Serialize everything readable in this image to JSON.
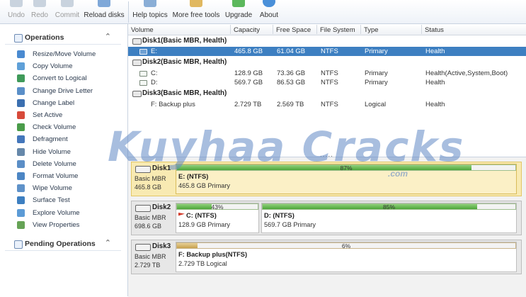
{
  "toolbar": {
    "undo": "Undo",
    "redo": "Redo",
    "commit": "Commit",
    "reload": "Reload disks",
    "help": "Help topics",
    "more_tools": "More free tools",
    "upgrade": "Upgrade",
    "about": "About"
  },
  "sidebar": {
    "operations_title": "Operations",
    "operations": [
      {
        "label": "Resize/Move Volume",
        "icon": "resize-icon",
        "color": "#4a8ad0"
      },
      {
        "label": "Copy Volume",
        "icon": "copy-icon",
        "color": "#5fa0d8"
      },
      {
        "label": "Convert to Logical",
        "icon": "convert-icon",
        "color": "#3f9a5a"
      },
      {
        "label": "Change Drive Letter",
        "icon": "drive-letter-icon",
        "color": "#5a8fc8"
      },
      {
        "label": "Change Label",
        "icon": "label-icon",
        "color": "#3b6fb0"
      },
      {
        "label": "Set Active",
        "icon": "set-active-icon",
        "color": "#d74a3a"
      },
      {
        "label": "Check Volume",
        "icon": "check-icon",
        "color": "#4a9c4a"
      },
      {
        "label": "Defragment",
        "icon": "defrag-icon",
        "color": "#4477bb"
      },
      {
        "label": "Hide Volume",
        "icon": "hide-icon",
        "color": "#6688aa"
      },
      {
        "label": "Delete Volume",
        "icon": "delete-icon",
        "color": "#5b8ec6"
      },
      {
        "label": "Format Volume",
        "icon": "format-icon",
        "color": "#4c86c4"
      },
      {
        "label": "Wipe Volume",
        "icon": "wipe-icon",
        "color": "#5f92c9"
      },
      {
        "label": "Surface Test",
        "icon": "surface-test-icon",
        "color": "#3d7fc1"
      },
      {
        "label": "Explore Volume",
        "icon": "explore-icon",
        "color": "#5c9bd6"
      },
      {
        "label": "View Properties",
        "icon": "properties-icon",
        "color": "#66a356"
      }
    ],
    "pending_title": "Pending Operations"
  },
  "table": {
    "columns": [
      "Volume",
      "Capacity",
      "Free Space",
      "File System",
      "Type",
      "Status"
    ],
    "disk1": {
      "name": "Disk1(Basic MBR, Health)",
      "volumes": [
        {
          "volume": "E:",
          "capacity": "465.8 GB",
          "free": "61.04 GB",
          "fs": "NTFS",
          "type": "Primary",
          "status": "Health"
        }
      ]
    },
    "disk2": {
      "name": "Disk2(Basic MBR, Health)",
      "volumes": [
        {
          "volume": "C:",
          "capacity": "128.9 GB",
          "free": "73.36 GB",
          "fs": "NTFS",
          "type": "Primary",
          "status": "Health(Active,System,Boot)"
        },
        {
          "volume": "D:",
          "capacity": "569.7 GB",
          "free": "86.53 GB",
          "fs": "NTFS",
          "type": "Primary",
          "status": "Health"
        }
      ]
    },
    "disk3": {
      "name": "Disk3(Basic MBR, Health)",
      "volumes": [
        {
          "volume": "F: Backup plus",
          "capacity": "2.729 TB",
          "free": "2.569 TB",
          "fs": "NTFS",
          "type": "Logical",
          "status": "Health"
        }
      ]
    }
  },
  "watermark": {
    "text": "Kuyhaa Cracks",
    "suffix": ".com"
  },
  "splitter_dots": ".....",
  "diskmap": {
    "disk1": {
      "name": "Disk1",
      "type": "Basic MBR",
      "size": "465.8 GB",
      "partitions": [
        {
          "label": "E: (NTFS)",
          "info": "465.8 GB Primary",
          "used_pct": 87,
          "pct_text": "87%"
        }
      ]
    },
    "disk2": {
      "name": "Disk2",
      "type": "Basic MBR",
      "size": "698.6 GB",
      "partitions": [
        {
          "label": "C: (NTFS)",
          "info": "128.9 GB Primary",
          "used_pct": 43,
          "pct_text": "43%"
        },
        {
          "label": "D: (NTFS)",
          "info": "569.7 GB Primary",
          "used_pct": 85,
          "pct_text": "85%"
        }
      ]
    },
    "disk3": {
      "name": "Disk3",
      "type": "Basic MBR",
      "size": "2.729 TB",
      "partitions": [
        {
          "label": "F: Backup plus(NTFS)",
          "info": "2.729 TB Logical",
          "used_pct": 6,
          "pct_text": "6%"
        }
      ]
    }
  },
  "colors": {
    "selection": "#3d7fc1",
    "used_green": "#4ea63a",
    "used_amber": "#c8a24e",
    "selected_disk_bg": "#f8eab2"
  }
}
